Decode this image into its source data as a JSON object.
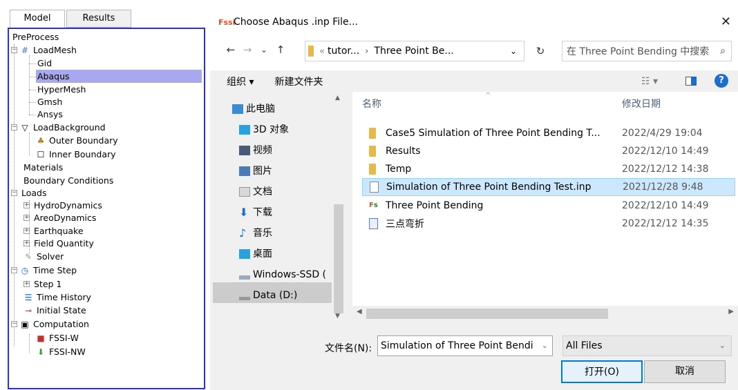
{
  "left_panel": {
    "tabs": [
      "Model",
      "Results"
    ],
    "tree": [
      {
        "label": "PreProcess"
      },
      {
        "label": "LoadMesh"
      },
      {
        "label": "Gid"
      },
      {
        "label": "Abaqus"
      },
      {
        "label": "HyperMesh"
      },
      {
        "label": "Gmsh"
      },
      {
        "label": "Ansys"
      },
      {
        "label": "LoadBackground"
      },
      {
        "label": "Outer Boundary"
      },
      {
        "label": "Inner Boundary"
      },
      {
        "label": "Materials"
      },
      {
        "label": "Boundary Conditions"
      },
      {
        "label": "Loads"
      },
      {
        "label": "HydroDynamics"
      },
      {
        "label": "AreoDynamics"
      },
      {
        "label": "Earthquake"
      },
      {
        "label": "Field Quantity"
      },
      {
        "label": "Solver"
      },
      {
        "label": "Time Step"
      },
      {
        "label": "Step 1"
      },
      {
        "label": "Time History"
      },
      {
        "label": "Initial State"
      },
      {
        "label": "Computation"
      },
      {
        "label": "FSSI-W"
      },
      {
        "label": "FSSI-NW"
      }
    ],
    "selected": "Abaqus"
  },
  "dialog": {
    "logo": "Fssi",
    "title": "Choose Abaqus .inp File...",
    "close": "✕",
    "nav": {
      "back": "←",
      "forward": "→",
      "dropdown": "⌄",
      "up": "↑",
      "refresh": "↻"
    },
    "breadcrumb": [
      "tutor...",
      "Three Point Be..."
    ],
    "breadcrumb_prefix": "«",
    "search_placeholder": "在 Three Point Bending 中搜索",
    "toolbar": {
      "organize": "组织 ▾",
      "new_folder": "新建文件夹"
    },
    "nav_pane": [
      "此电脑",
      "3D 对象",
      "视频",
      "图片",
      "文档",
      "下载",
      "音乐",
      "桌面",
      "Windows-SSD (",
      "Data (D:)"
    ],
    "columns": {
      "name": "名称",
      "date": "修改日期"
    },
    "files": [
      {
        "name": "Case5 Simulation of Three Point Bending T...",
        "date": "2022/4/29 19:04",
        "type": "folder"
      },
      {
        "name": "Results",
        "date": "2022/12/10 14:49",
        "type": "folder"
      },
      {
        "name": "Temp",
        "date": "2022/12/12 14:38",
        "type": "folder"
      },
      {
        "name": "Simulation of Three Point Bending Test.inp",
        "date": "2021/12/28 9:48",
        "type": "file"
      },
      {
        "name": "Three Point Bending",
        "date": "2022/12/10 14:49",
        "type": "app"
      },
      {
        "name": "三点弯折",
        "date": "2022/12/12 14:35",
        "type": "doc"
      }
    ],
    "filename_label": "文件名(N):",
    "filename_value": "Simulation of Three Point Bendi",
    "filter": "All Files",
    "open_button": "打开(O)",
    "cancel_button": "取消"
  }
}
